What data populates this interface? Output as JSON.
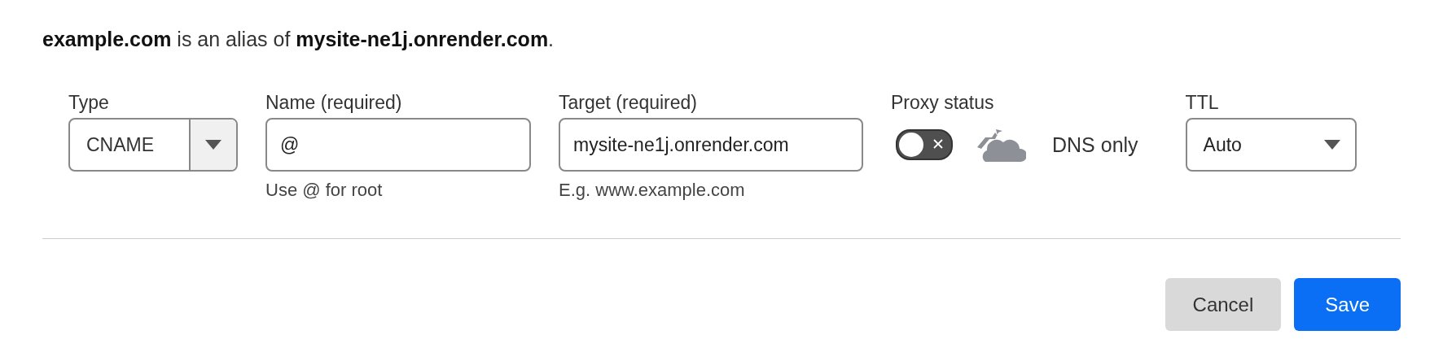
{
  "summary": "**example.com** is an alias of **mysite-ne1j.onrender.com**.",
  "fields": [
    {
      "kind": "select",
      "label": "Type",
      "value": "CNAME"
    },
    {
      "kind": "input",
      "label": "Name (required)",
      "value": "@",
      "hint": "Use @ for root"
    },
    {
      "kind": "input",
      "label": "Target (required)",
      "value": "mysite-ne1j.onrender.com",
      "hint": "E.g. www.example.com"
    },
    {
      "kind": "proxy",
      "label": "Proxy status",
      "on": false,
      "status": "DNS only"
    },
    {
      "kind": "dropdown",
      "label": "TTL",
      "value": "Auto"
    }
  ],
  "buttons": [
    {
      "kind": "secondary",
      "label": "Cancel"
    },
    {
      "kind": "primary",
      "label": "Save"
    }
  ]
}
